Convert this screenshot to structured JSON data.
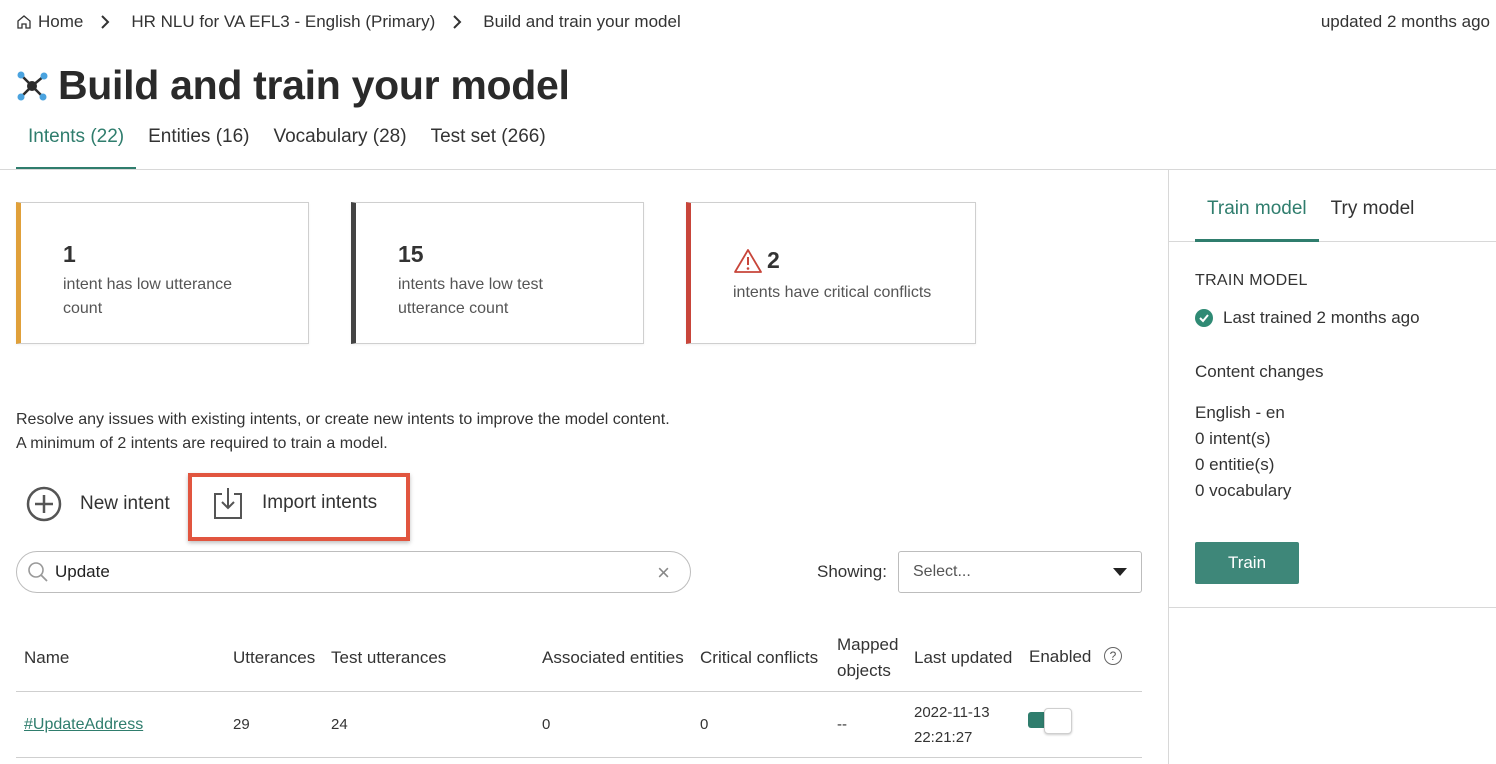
{
  "breadcrumb": {
    "home": "Home",
    "project": "HR NLU for VA EFL3 - English (Primary)",
    "current": "Build and train your model"
  },
  "updated": "updated  2 months ago",
  "page": {
    "title": "Build and train your model"
  },
  "tabs": [
    {
      "label": "Intents (22)",
      "active": true
    },
    {
      "label": "Entities (16)"
    },
    {
      "label": "Vocabulary (28)"
    },
    {
      "label": "Test set (266)"
    }
  ],
  "cards": [
    {
      "count": "1",
      "text": "intent has low utterance count",
      "accent": "#e0a03a"
    },
    {
      "count": "15",
      "text": "intents have low test utterance count",
      "accent": "#444444"
    },
    {
      "count": "2",
      "text": "intents have critical conflicts",
      "accent": "#c8453a",
      "icon": "warning-icon"
    }
  ],
  "info": {
    "line1": "Resolve any issues with existing intents, or create new intents to improve the model content.",
    "line2": "A minimum of 2 intents are required to train a model."
  },
  "actions": {
    "new_intent": "New intent",
    "import_intents": "Import intents",
    "highlight_color": "#e1553f"
  },
  "search": {
    "value": "Update",
    "placeholder": ""
  },
  "filter": {
    "label": "Showing:",
    "value": "Select..."
  },
  "table": {
    "headers": [
      "Name",
      "Utterances",
      "Test utterances",
      "Associated entities",
      "Critical conflicts",
      "Mapped objects",
      "Last updated",
      "Enabled"
    ],
    "rows": [
      {
        "name": "#UpdateAddress",
        "utterances": "29",
        "test_utterances": "24",
        "associated_entities": "0",
        "critical_conflicts": "0",
        "mapped_objects": "--",
        "last_updated_date": "2022-11-13",
        "last_updated_time": "22:21:27",
        "enabled": true
      }
    ]
  },
  "right_panel": {
    "tabs": [
      {
        "label": "Train model",
        "active": true
      },
      {
        "label": "Try model"
      }
    ],
    "heading": "TRAIN MODEL",
    "last_trained": "Last trained 2 months ago",
    "content_changes": "Content changes",
    "language": "English - en",
    "intents": "0 intent(s)",
    "entities": "0 entitie(s)",
    "vocabulary": "0 vocabulary",
    "train_button": "Train"
  },
  "colors": {
    "accent": "#2f7d6d",
    "train_button": "#3e8779"
  }
}
